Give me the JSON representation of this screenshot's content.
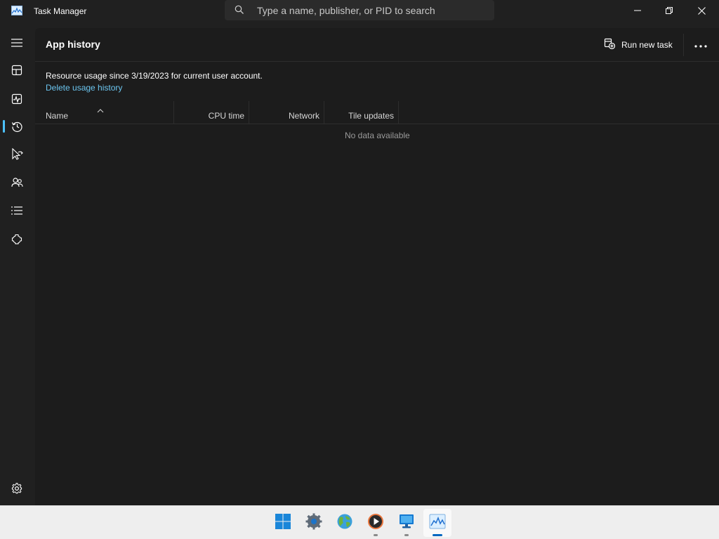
{
  "window": {
    "title": "Task Manager",
    "app_icon": "task-manager-icon"
  },
  "search": {
    "placeholder": "Type a name, publisher, or PID to search",
    "icon": "search-icon"
  },
  "window_controls": [
    "minimize-icon",
    "restore-icon",
    "close-icon"
  ],
  "nav": {
    "items": [
      {
        "icon": "hamburger-menu-icon",
        "active": false
      },
      {
        "icon": "processes-icon",
        "active": false
      },
      {
        "icon": "performance-icon",
        "active": false
      },
      {
        "icon": "app-history-icon",
        "active": true
      },
      {
        "icon": "startup-apps-icon",
        "active": false
      },
      {
        "icon": "users-icon",
        "active": false
      },
      {
        "icon": "details-icon",
        "active": false
      },
      {
        "icon": "services-icon",
        "active": false
      }
    ],
    "settings_icon": "settings-gear-icon"
  },
  "page": {
    "title": "App history",
    "run_new_task_label": "Run new task",
    "more_icon": "more-options-icon",
    "info_text": "Resource usage since 3/19/2023 for current user account.",
    "delete_link": "Delete usage history"
  },
  "table": {
    "columns": [
      "Name",
      "CPU time",
      "Network",
      "Tile updates"
    ],
    "sorted_column": "Name",
    "empty_message": "No data available"
  },
  "taskbar": {
    "items": [
      {
        "icon": "start-windows-icon",
        "running": false,
        "active": false
      },
      {
        "icon": "settings-app-icon",
        "running": false,
        "active": false
      },
      {
        "icon": "earth-globe-icon",
        "running": false,
        "active": false
      },
      {
        "icon": "media-player-icon",
        "running": true,
        "active": false
      },
      {
        "icon": "remote-desktop-icon",
        "running": true,
        "active": false
      },
      {
        "icon": "task-manager-app-icon",
        "running": true,
        "active": true
      }
    ]
  },
  "colors": {
    "accent": "#4cc2ff",
    "link": "#6cc6f0",
    "background": "#202020",
    "panel": "#1c1c1c",
    "taskbar": "#eeeeee"
  }
}
